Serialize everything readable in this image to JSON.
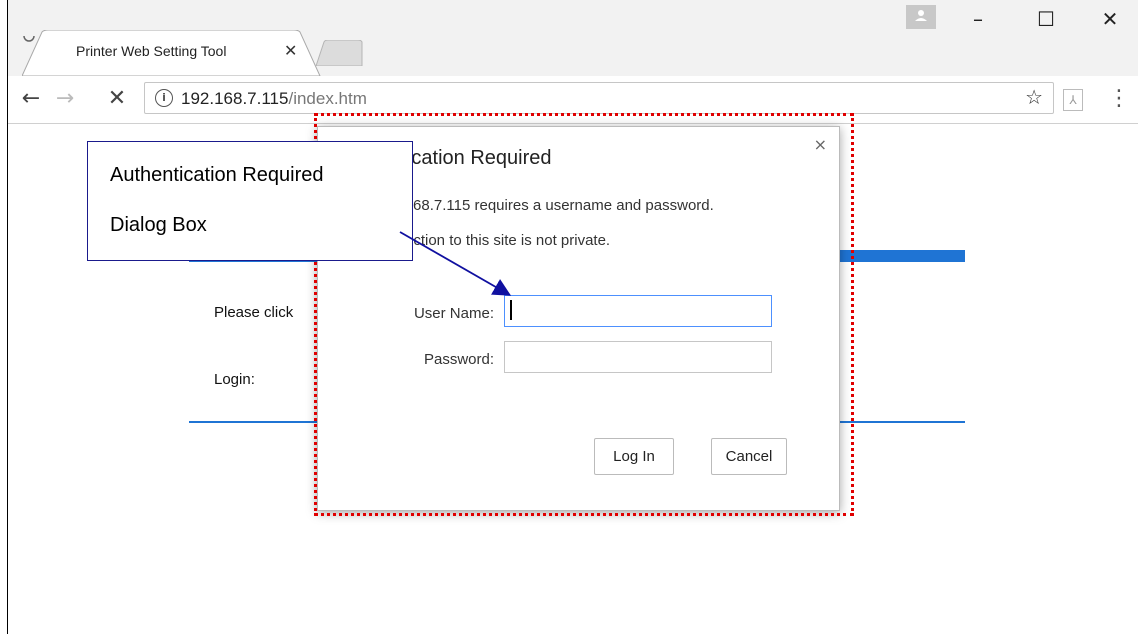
{
  "browser": {
    "tab": {
      "title": "Printer Web Setting Tool",
      "close_glyph": "✕"
    },
    "window_controls": {
      "minimize_glyph": "–",
      "maximize_glyph": "☐",
      "close_glyph": "✕"
    },
    "toolbar": {
      "back_glyph": "←",
      "forward_glyph": "→",
      "stop_glyph": "✕",
      "url_host": "192.168.7.115",
      "url_path": "/index.htm",
      "star_glyph": "☆",
      "menu_glyph": "⋮"
    }
  },
  "page": {
    "please_text": "Please click",
    "login_label": "Login:"
  },
  "dialog": {
    "title": "Authentication Required",
    "message_1": "http://192.168.7.115 requires a username and password.",
    "message_2": "Your connection to this site is not private.",
    "username_label": "User Name:",
    "username_value": "",
    "password_label": "Password:",
    "password_value": "",
    "login_button": "Log In",
    "cancel_button": "Cancel",
    "close_glyph": "×"
  },
  "annotation": {
    "callout_line1": "Authentication Required",
    "callout_line2": "Dialog Box"
  },
  "colors": {
    "highlight": "#e00000",
    "accent_blue": "#1f74d4",
    "callout_border": "#1a1a8c"
  }
}
